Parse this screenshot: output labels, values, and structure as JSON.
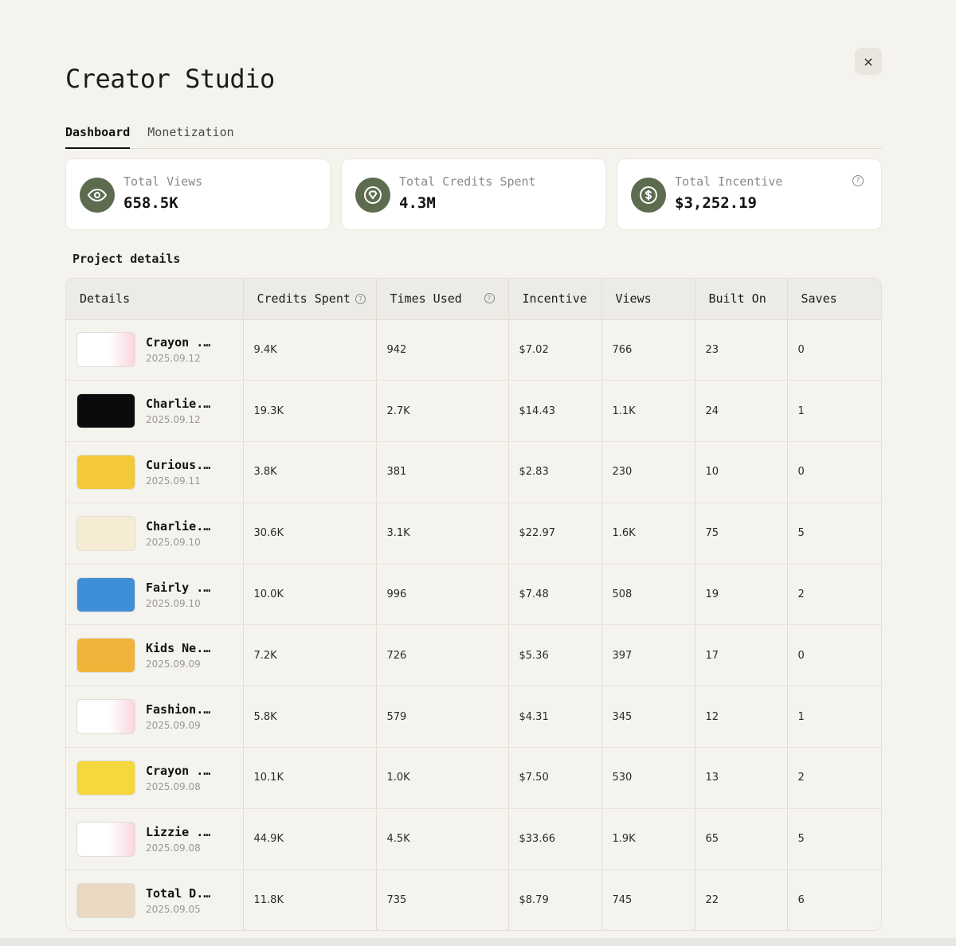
{
  "app": {
    "title": "Creator Studio",
    "close_label": "×"
  },
  "tabs": [
    {
      "label": "Dashboard",
      "active": true
    },
    {
      "label": "Monetization",
      "active": false
    }
  ],
  "stats": [
    {
      "label": "Total Views",
      "value": "658.5K",
      "icon": "eye-icon"
    },
    {
      "label": "Total Credits Spent",
      "value": "4.3M",
      "icon": "gem-icon"
    },
    {
      "label": "Total Incentive",
      "value": "$3,252.19",
      "icon": "dollar-icon",
      "help": "?"
    }
  ],
  "section_title": "Project details",
  "table": {
    "headers": [
      "Details",
      "Credits Spent",
      "Times Used",
      "Incentive",
      "Views",
      "Built On",
      "Saves"
    ],
    "help_glyph": "?",
    "rows": [
      {
        "name": "Crayon ...",
        "date": "2025.09.12",
        "credits": "9.4K",
        "used": "942",
        "incentive": "$7.02",
        "views": "766",
        "built": "23",
        "saves": "0",
        "thumb": "pink"
      },
      {
        "name": "Charlie...",
        "date": "2025.09.12",
        "credits": "19.3K",
        "used": "2.7K",
        "incentive": "$14.43",
        "views": "1.1K",
        "built": "24",
        "saves": "1",
        "thumb": "black"
      },
      {
        "name": "Curious...",
        "date": "2025.09.11",
        "credits": "3.8K",
        "used": "381",
        "incentive": "$2.83",
        "views": "230",
        "built": "10",
        "saves": "0",
        "thumb": "yellow"
      },
      {
        "name": "Charlie...",
        "date": "2025.09.10",
        "credits": "30.6K",
        "used": "3.1K",
        "incentive": "$22.97",
        "views": "1.6K",
        "built": "75",
        "saves": "5",
        "thumb": "cream"
      },
      {
        "name": "Fairly ...",
        "date": "2025.09.10",
        "credits": "10.0K",
        "used": "996",
        "incentive": "$7.48",
        "views": "508",
        "built": "19",
        "saves": "2",
        "thumb": "blue"
      },
      {
        "name": "Kids Ne...",
        "date": "2025.09.09",
        "credits": "7.2K",
        "used": "726",
        "incentive": "$5.36",
        "views": "397",
        "built": "17",
        "saves": "0",
        "thumb": "orange"
      },
      {
        "name": "Fashion...",
        "date": "2025.09.09",
        "credits": "5.8K",
        "used": "579",
        "incentive": "$4.31",
        "views": "345",
        "built": "12",
        "saves": "1",
        "thumb": "pink"
      },
      {
        "name": "Crayon ...",
        "date": "2025.09.08",
        "credits": "10.1K",
        "used": "1.0K",
        "incentive": "$7.50",
        "views": "530",
        "built": "13",
        "saves": "2",
        "thumb": "yellow2"
      },
      {
        "name": "Lizzie ...",
        "date": "2025.09.08",
        "credits": "44.9K",
        "used": "4.5K",
        "incentive": "$33.66",
        "views": "1.9K",
        "built": "65",
        "saves": "5",
        "thumb": "pink"
      },
      {
        "name": "Total D...",
        "date": "2025.09.05",
        "credits": "11.8K",
        "used": "735",
        "incentive": "$8.79",
        "views": "745",
        "built": "22",
        "saves": "6",
        "thumb": "tan"
      }
    ]
  },
  "colors": {
    "accent": "#5d6b4f",
    "background": "#f5f3ee",
    "card": "#ffffff"
  }
}
